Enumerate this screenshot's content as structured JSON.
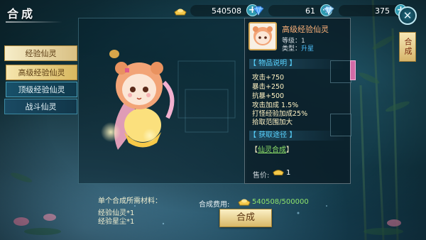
{
  "screen": {
    "title": "合成"
  },
  "currencies": [
    {
      "icon": "gold-ingot-icon",
      "value": "540508"
    },
    {
      "icon": "blue-diamond-icon",
      "value": "61"
    },
    {
      "icon": "silver-diamond-icon",
      "value": "375"
    }
  ],
  "side_tag": "合成",
  "menu": {
    "category": "经验仙灵",
    "items": [
      {
        "label": "高级经验仙灵",
        "state": "selected"
      },
      {
        "label": "顶级经验仙灵",
        "state": "normal"
      }
    ],
    "other_category": "战斗仙灵"
  },
  "item": {
    "name": "高级经验仙灵",
    "level": "等级：1",
    "type_label": "类型：",
    "type_value": "升星",
    "desc_header": "【 物品说明 】",
    "attributes": [
      "攻击+750",
      "暴击+250",
      "抗暴+500",
      "攻击加成 1.5%",
      "打怪经验加成25%",
      "拾取范围加大"
    ],
    "source_header": "【 获取途径 】",
    "source_prefix": "【",
    "source_link": "仙灵合成",
    "source_suffix": "】",
    "price_label": "售价:",
    "price_value": "1"
  },
  "materials": {
    "header": "单个合成所需材料：",
    "list": [
      "经验仙灵*1",
      "经验星尘*1"
    ]
  },
  "cost": {
    "label": "合成费用:",
    "value": "540508/500000"
  },
  "combine_button": "合成",
  "colors": {
    "accent": "#59d3ff",
    "gold_button": "#d9b868",
    "green_text": "#8fe36b"
  }
}
